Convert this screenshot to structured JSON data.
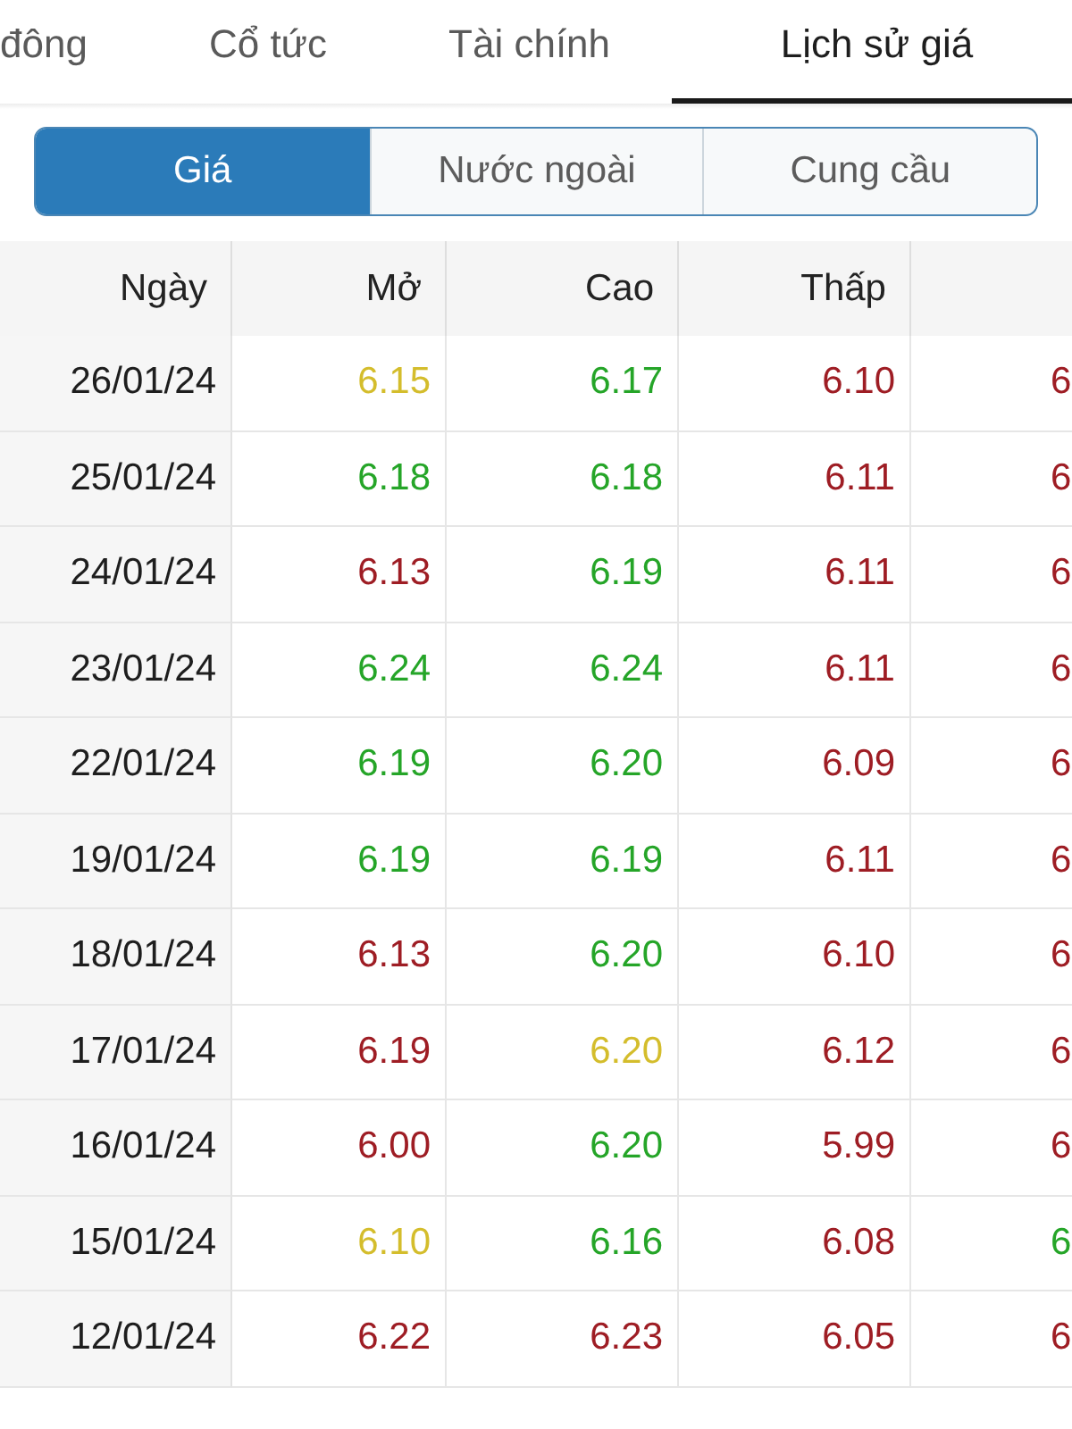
{
  "tabs": [
    {
      "label": "đông",
      "selected": false
    },
    {
      "label": "Cổ tức",
      "selected": false
    },
    {
      "label": "Tài chính",
      "selected": false
    },
    {
      "label": "Lịch sử giá",
      "selected": true
    }
  ],
  "segments": [
    {
      "label": "Giá",
      "selected": true
    },
    {
      "label": "Nước ngoài",
      "selected": false
    },
    {
      "label": "Cung cầu",
      "selected": false
    }
  ],
  "table": {
    "columns": [
      "Ngày",
      "Mở",
      "Cao",
      "Thấp"
    ],
    "rows": [
      {
        "cells": [
          {
            "value": "26/01/24"
          },
          {
            "value": "6.15",
            "color": "#d4bd2c"
          },
          {
            "value": "6.17",
            "color": "#25a528"
          },
          {
            "value": "6.10",
            "color": "#9e1d24"
          },
          {
            "value": "6",
            "color": "#9e1d24"
          }
        ]
      },
      {
        "cells": [
          {
            "value": "25/01/24"
          },
          {
            "value": "6.18",
            "color": "#25a528"
          },
          {
            "value": "6.18",
            "color": "#25a528"
          },
          {
            "value": "6.11",
            "color": "#9e1d24"
          },
          {
            "value": "6",
            "color": "#9e1d24"
          }
        ]
      },
      {
        "cells": [
          {
            "value": "24/01/24"
          },
          {
            "value": "6.13",
            "color": "#9e1d24"
          },
          {
            "value": "6.19",
            "color": "#25a528"
          },
          {
            "value": "6.11",
            "color": "#9e1d24"
          },
          {
            "value": "6",
            "color": "#9e1d24"
          }
        ]
      },
      {
        "cells": [
          {
            "value": "23/01/24"
          },
          {
            "value": "6.24",
            "color": "#25a528"
          },
          {
            "value": "6.24",
            "color": "#25a528"
          },
          {
            "value": "6.11",
            "color": "#9e1d24"
          },
          {
            "value": "6",
            "color": "#9e1d24"
          }
        ]
      },
      {
        "cells": [
          {
            "value": "22/01/24"
          },
          {
            "value": "6.19",
            "color": "#25a528"
          },
          {
            "value": "6.20",
            "color": "#25a528"
          },
          {
            "value": "6.09",
            "color": "#9e1d24"
          },
          {
            "value": "6",
            "color": "#9e1d24"
          }
        ]
      },
      {
        "cells": [
          {
            "value": "19/01/24"
          },
          {
            "value": "6.19",
            "color": "#25a528"
          },
          {
            "value": "6.19",
            "color": "#25a528"
          },
          {
            "value": "6.11",
            "color": "#9e1d24"
          },
          {
            "value": "6",
            "color": "#9e1d24"
          }
        ]
      },
      {
        "cells": [
          {
            "value": "18/01/24"
          },
          {
            "value": "6.13",
            "color": "#9e1d24"
          },
          {
            "value": "6.20",
            "color": "#25a528"
          },
          {
            "value": "6.10",
            "color": "#9e1d24"
          },
          {
            "value": "6",
            "color": "#9e1d24"
          }
        ]
      },
      {
        "cells": [
          {
            "value": "17/01/24"
          },
          {
            "value": "6.19",
            "color": "#9e1d24"
          },
          {
            "value": "6.20",
            "color": "#d4bd2c"
          },
          {
            "value": "6.12",
            "color": "#9e1d24"
          },
          {
            "value": "6",
            "color": "#9e1d24"
          }
        ]
      },
      {
        "cells": [
          {
            "value": "16/01/24"
          },
          {
            "value": "6.00",
            "color": "#9e1d24"
          },
          {
            "value": "6.20",
            "color": "#25a528"
          },
          {
            "value": "5.99",
            "color": "#9e1d24"
          },
          {
            "value": "6",
            "color": "#9e1d24"
          }
        ]
      },
      {
        "cells": [
          {
            "value": "15/01/24"
          },
          {
            "value": "6.10",
            "color": "#d4bd2c"
          },
          {
            "value": "6.16",
            "color": "#25a528"
          },
          {
            "value": "6.08",
            "color": "#9e1d24"
          },
          {
            "value": "6",
            "color": "#25a528"
          }
        ]
      },
      {
        "cells": [
          {
            "value": "12/01/24"
          },
          {
            "value": "6.22",
            "color": "#9e1d24"
          },
          {
            "value": "6.23",
            "color": "#9e1d24"
          },
          {
            "value": "6.05",
            "color": "#9e1d24"
          },
          {
            "value": "6",
            "color": "#9e1d24"
          }
        ]
      }
    ]
  }
}
